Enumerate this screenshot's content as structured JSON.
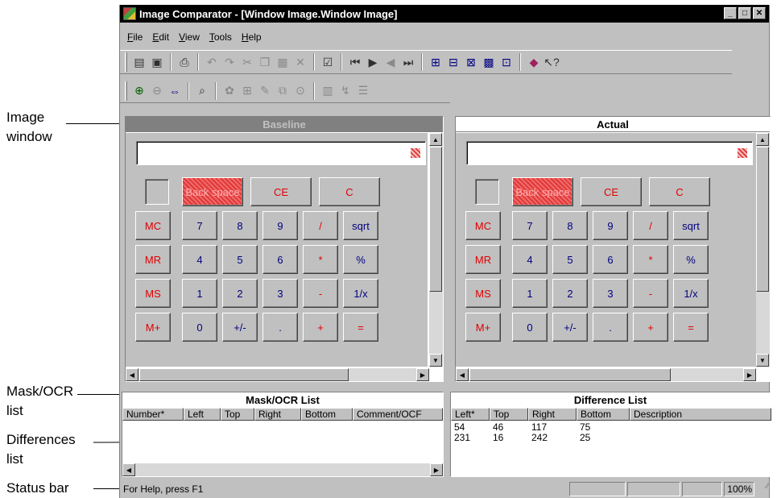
{
  "window": {
    "title": "Image Comparator - [Window Image.Window Image]",
    "controls": [
      "_",
      "□",
      "✕"
    ]
  },
  "menu": [
    {
      "mnemonic": "F",
      "rest": "ile"
    },
    {
      "mnemonic": "E",
      "rest": "dit"
    },
    {
      "mnemonic": "V",
      "rest": "iew"
    },
    {
      "mnemonic": "T",
      "rest": "ools"
    },
    {
      "mnemonic": "H",
      "rest": "elp"
    }
  ],
  "baseline": {
    "title": "Baseline",
    "header_bg": "#808080",
    "header_fg": "#c0c0c0"
  },
  "actual": {
    "title": "Actual",
    "header_bg": "#ffffff",
    "header_fg": "#000000"
  },
  "calculator": {
    "backspace": "Back space",
    "ce": "CE",
    "c": "C",
    "memory": [
      "MC",
      "MR",
      "MS",
      "M+"
    ],
    "rows": [
      [
        "7",
        "8",
        "9",
        "/",
        "sqrt"
      ],
      [
        "4",
        "5",
        "6",
        "*",
        "%"
      ],
      [
        "1",
        "2",
        "3",
        "-",
        "1/x"
      ],
      [
        "0",
        "+/-",
        ".",
        "+",
        "="
      ]
    ]
  },
  "mask_list": {
    "title": "Mask/OCR List",
    "columns": [
      "Number*",
      "Left",
      "Top",
      "Right",
      "Bottom",
      "Comment/OCF"
    ]
  },
  "difference_list": {
    "title": "Difference List",
    "columns": [
      "Left*",
      "Top",
      "Right",
      "Bottom",
      "Description"
    ],
    "rows": [
      [
        "54",
        "46",
        "117",
        "75"
      ],
      [
        "231",
        "16",
        "242",
        "25"
      ]
    ]
  },
  "status": {
    "text": "For Help, press F1",
    "zoom": "100%"
  },
  "callouts": {
    "image_window": [
      "Image",
      "window"
    ],
    "mask_list": [
      "Mask/OCR",
      "list"
    ],
    "differences": [
      "Differences",
      "list"
    ],
    "status_bar": "Status bar"
  },
  "colors": {
    "titlebar": "#000000",
    "face": "#c0c0c0",
    "digit": "#000080",
    "operator": "#e00000"
  }
}
